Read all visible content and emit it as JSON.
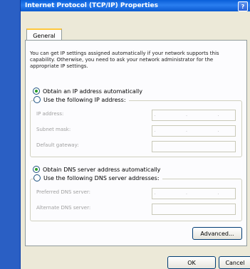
{
  "window": {
    "title": "Internet Protocol (TCP/IP) Properties",
    "help_label": "?"
  },
  "tabs": [
    {
      "label": "General"
    }
  ],
  "description": "You can get IP settings assigned automatically if your network supports this capability. Otherwise, you need to ask your network administrator for the appropriate IP settings.",
  "ip": {
    "auto_label": "Obtain an IP address automatically",
    "manual_label": "Use the following IP address:",
    "fields": [
      {
        "label": "IP address:",
        "value": ". . ."
      },
      {
        "label": "Subnet mask:",
        "value": ". . ."
      },
      {
        "label": "Default gateway:",
        "value": ""
      }
    ]
  },
  "dns": {
    "auto_label": "Obtain DNS server address automatically",
    "manual_label": "Use the following DNS server addresses:",
    "fields": [
      {
        "label": "Preferred DNS server:",
        "value": ". . ."
      },
      {
        "label": "Alternate DNS server:",
        "value": ""
      }
    ]
  },
  "buttons": {
    "advanced": "Advanced...",
    "ok": "OK",
    "cancel": "Cancel"
  }
}
